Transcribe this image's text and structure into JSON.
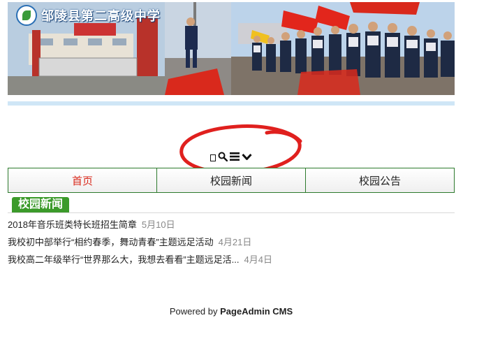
{
  "header": {
    "school_name": "邹陵县第二高级中学"
  },
  "toolbar": {
    "icons": [
      "missing-glyph-icon",
      "search-icon",
      "menu-icon",
      "chevron-down-icon"
    ]
  },
  "nav": {
    "items": [
      {
        "label": "首页",
        "active": true
      },
      {
        "label": "校园新闻",
        "active": false
      },
      {
        "label": "校园公告",
        "active": false
      }
    ]
  },
  "news_section": {
    "title": "校园新闻",
    "items": [
      {
        "title": "2018年音乐班类特长班招生简章",
        "date": "5月10日"
      },
      {
        "title": "我校初中部举行“相约春季，舞动青春”主题远足活动",
        "date": "4月21日"
      },
      {
        "title": "我校高二年级举行“世界那么大，我想去看看”主题远足活...",
        "date": "4月4日"
      }
    ]
  },
  "footer": {
    "prefix": "Powered by",
    "brand": "PageAdmin CMS"
  },
  "colors": {
    "nav_border": "#2d7a2d",
    "nav_active": "#d9291c",
    "section_tab": "#3b9a2a",
    "annotation": "#e0201e"
  }
}
